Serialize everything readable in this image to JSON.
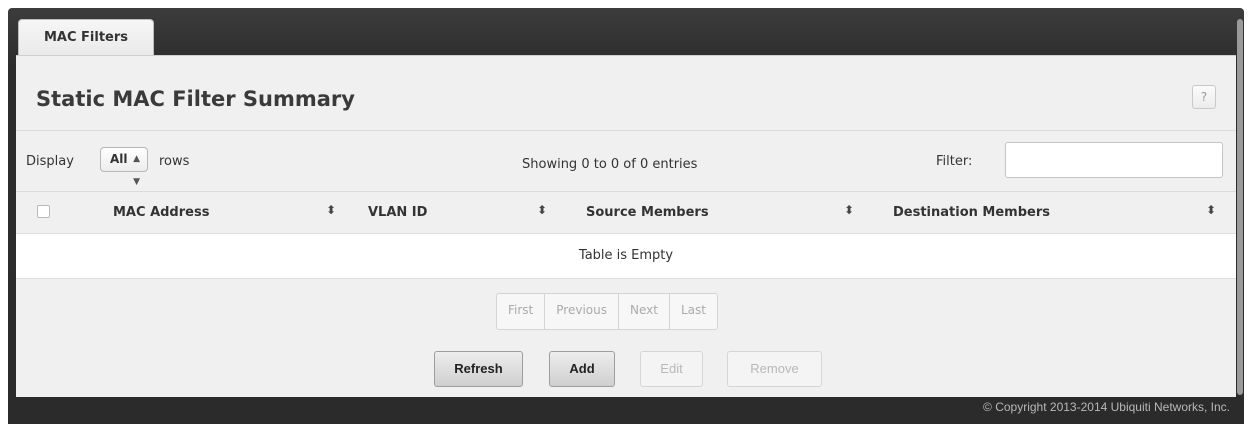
{
  "tab": {
    "label": "MAC Filters"
  },
  "header": {
    "title": "Static MAC Filter Summary",
    "help_label": "?"
  },
  "toolbar": {
    "display_label": "Display",
    "rows_selected": "All",
    "rows_label": "rows",
    "info": "Showing 0 to 0 of 0 entries",
    "filter_label": "Filter:",
    "filter_value": ""
  },
  "table": {
    "columns": [
      "MAC Address",
      "VLAN ID",
      "Source Members",
      "Destination Members"
    ],
    "sort_icon": "⬍",
    "empty_message": "Table is Empty"
  },
  "pagination": {
    "first": "First",
    "previous": "Previous",
    "next": "Next",
    "last": "Last"
  },
  "actions": {
    "refresh": "Refresh",
    "add": "Add",
    "edit": "Edit",
    "remove": "Remove"
  },
  "footer": {
    "copyright": "© Copyright 2013-2014 Ubiquiti Networks, Inc."
  }
}
